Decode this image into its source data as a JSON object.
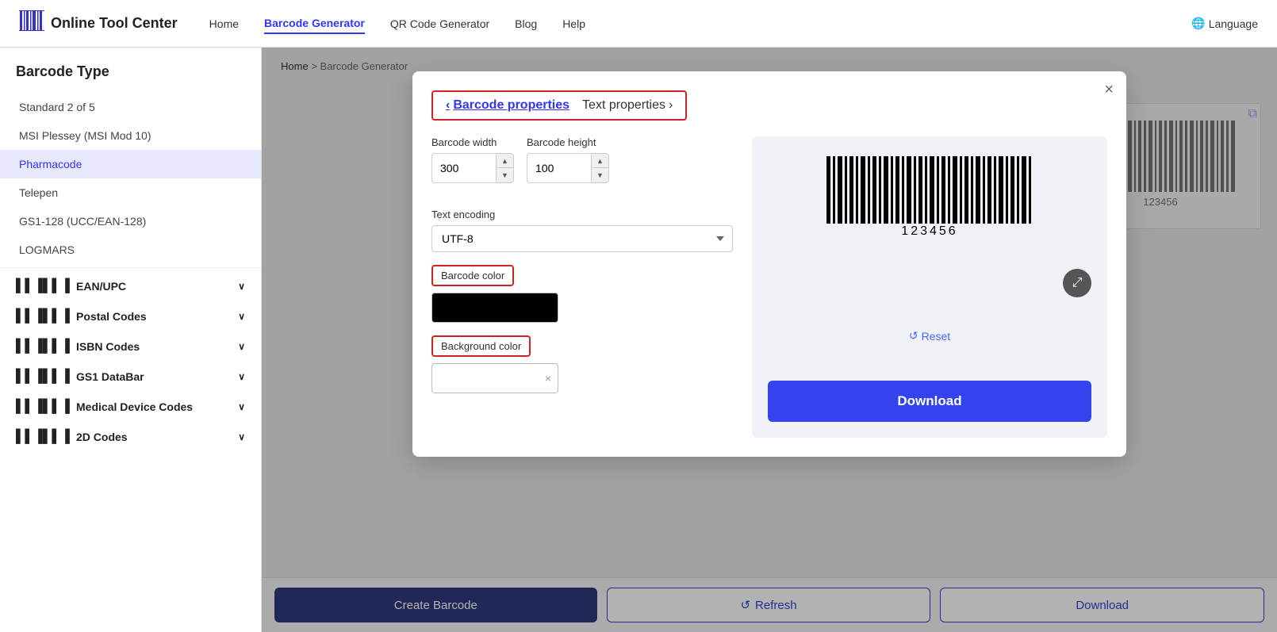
{
  "header": {
    "logo_text": "Online Tool Center",
    "nav": [
      {
        "label": "Home",
        "active": false
      },
      {
        "label": "Barcode Generator",
        "active": true
      },
      {
        "label": "QR Code Generator",
        "active": false
      },
      {
        "label": "Blog",
        "active": false
      },
      {
        "label": "Help",
        "active": false
      }
    ],
    "language_label": "Language"
  },
  "sidebar": {
    "title": "Barcode Type",
    "items": [
      {
        "label": "Standard 2 of 5",
        "active": false,
        "indent": true
      },
      {
        "label": "MSI Plessey (MSI Mod 10)",
        "active": false,
        "indent": true
      },
      {
        "label": "Pharmacode",
        "active": true,
        "indent": true
      },
      {
        "label": "Telepen",
        "active": false,
        "indent": true
      },
      {
        "label": "GS1-128 (UCC/EAN-128)",
        "active": false,
        "indent": true
      },
      {
        "label": "LOGMARS",
        "active": false,
        "indent": true
      }
    ],
    "groups": [
      {
        "label": "EAN/UPC",
        "icon": "barcode"
      },
      {
        "label": "Postal Codes",
        "icon": "barcode"
      },
      {
        "label": "ISBN Codes",
        "icon": "barcode"
      },
      {
        "label": "GS1 DataBar",
        "icon": "barcode"
      },
      {
        "label": "Medical Device Codes",
        "icon": "barcode"
      },
      {
        "label": "2D Codes",
        "icon": "barcode"
      }
    ]
  },
  "breadcrumb": {
    "home": "Home",
    "separator": ">",
    "current": "Barcode Generator"
  },
  "bottom_bar": {
    "create_label": "Create Barcode",
    "refresh_label": "Refresh",
    "download_label": "Download"
  },
  "modal": {
    "tab_barcode_props": "Barcode properties",
    "tab_text_props": "Text properties",
    "close_label": "×",
    "barcode_width_label": "Barcode width",
    "barcode_width_value": "300",
    "barcode_height_label": "Barcode height",
    "barcode_height_value": "100",
    "text_encoding_label": "Text encoding",
    "text_encoding_value": "UTF-8",
    "barcode_color_label": "Barcode color",
    "background_color_label": "Background color",
    "barcode_number": "123456",
    "reset_label": "Reset",
    "download_label": "Download",
    "zoom_icon": "⤢"
  },
  "bg_barcode": {
    "number": "123456"
  }
}
